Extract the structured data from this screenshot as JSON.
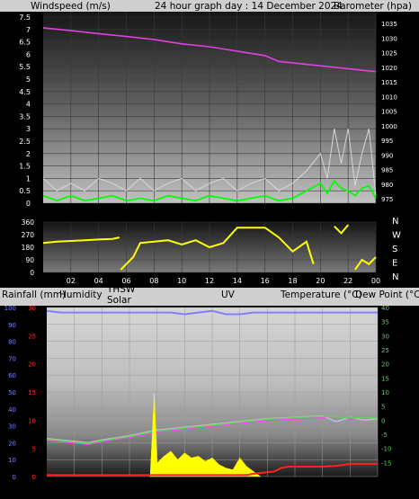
{
  "colors": {
    "background": "#000000",
    "label_bar": "#cfcfcf",
    "axis_text_dark": "#000000",
    "axis_text_light": "#ffffff",
    "pink": "#e040e0",
    "gust": "#d8d8d8",
    "wind": "#00ff00",
    "direction": "#ffff00",
    "humidity": "#8080ff",
    "thsw": "#c0c0c0",
    "temperature": "#ff40ff",
    "dewpoint": "#60d060",
    "solar": "#ffff00",
    "uv": "#ff2020"
  },
  "top": {
    "left_label": "Windspeed (m/s)",
    "title": "24 hour graph day : 14 December 2024",
    "right_label": "Barometer (hpa)"
  },
  "direction_letters": [
    "N",
    "W",
    "S",
    "E",
    "N"
  ],
  "bottom": {
    "labels": [
      "Rainfall (mm)",
      "Humidity",
      "THSW",
      "Solar",
      "UV",
      "Temperature (°C)",
      "Dew Point (°C)"
    ],
    "sunrise_label": "SunRise",
    "sunset_label": "SunSet"
  },
  "chart_data": [
    {
      "type": "line",
      "title": "24 hour graph day : 14 December 2024",
      "x_ticks": [
        "02",
        "04",
        "06",
        "08",
        "10",
        "12",
        "14",
        "16",
        "18",
        "20",
        "22",
        "00"
      ],
      "xlim_hours": [
        0,
        24
      ],
      "ylabel": "Windspeed (m/s)",
      "ylim": [
        0,
        7.5
      ],
      "y_ticks": [
        "0",
        "0.5",
        "1",
        "1.5",
        "2",
        "2.5",
        "3",
        "3.5",
        "4",
        "4.5",
        "5",
        "5.5",
        "6",
        "6.5",
        "7",
        "7.5"
      ],
      "y2label": "Barometer (hpa)",
      "y2lim": [
        973.5,
        1039
      ],
      "y2_ticks": [
        "975",
        "980",
        "985",
        "990",
        "995",
        "1000",
        "1005",
        "1010",
        "1015",
        "1020",
        "1025",
        "1030",
        "1035"
      ],
      "series": [
        {
          "name": "Barometer (hpa)",
          "axis": "right",
          "x": [
            0,
            2,
            4,
            6,
            8,
            10,
            12,
            14,
            16,
            17,
            18,
            20,
            22,
            24
          ],
          "values": [
            1033.5,
            1032.5,
            1031.5,
            1030.5,
            1029.5,
            1028,
            1027,
            1025.5,
            1024,
            1022,
            1021.5,
            1020.5,
            1019.5,
            1018.5
          ]
        },
        {
          "name": "Gust",
          "axis": "left",
          "x": [
            0,
            1,
            2,
            3,
            4,
            5,
            6,
            7,
            8,
            9,
            10,
            11,
            12,
            13,
            14,
            15,
            16,
            17,
            18,
            19,
            20,
            20.5,
            21,
            21.5,
            22,
            22.5,
            23,
            23.5,
            24
          ],
          "values": [
            1,
            0.5,
            0.8,
            0.5,
            1,
            0.8,
            0.5,
            1,
            0.5,
            0.8,
            1,
            0.5,
            0.8,
            1,
            0.5,
            0.8,
            1,
            0.5,
            0.8,
            1.3,
            2,
            1,
            3,
            1.6,
            3,
            0.7,
            2,
            3,
            0.3
          ]
        },
        {
          "name": "Windspeed",
          "axis": "left",
          "x": [
            0,
            1,
            2,
            3,
            4,
            5,
            6,
            7,
            8,
            9,
            10,
            11,
            12,
            13,
            14,
            15,
            16,
            17,
            18,
            19,
            20,
            20.5,
            21,
            21.5,
            22,
            22.5,
            23,
            23.5,
            24
          ],
          "values": [
            0.3,
            0.1,
            0.3,
            0.1,
            0.2,
            0.3,
            0.1,
            0.2,
            0.1,
            0.3,
            0.2,
            0.1,
            0.3,
            0.2,
            0.1,
            0.2,
            0.3,
            0.1,
            0.2,
            0.5,
            0.8,
            0.4,
            0.9,
            0.6,
            0.5,
            0.3,
            0.6,
            0.7,
            0.2
          ]
        }
      ]
    },
    {
      "type": "line",
      "x_ticks": [
        "02",
        "04",
        "06",
        "08",
        "10",
        "12",
        "14",
        "16",
        "18",
        "20",
        "22",
        "00"
      ],
      "xlim_hours": [
        0,
        24
      ],
      "ylim": [
        0,
        360
      ],
      "y_ticks": [
        "0",
        "90",
        "180",
        "270",
        "360"
      ],
      "right_ticks": [
        "N",
        "W",
        "S",
        "E",
        "N"
      ],
      "series": [
        {
          "name": "Wind direction",
          "x": [
            0,
            1,
            2,
            3,
            4,
            5,
            5.5,
            5.6,
            6,
            6.5,
            7,
            8,
            9,
            10,
            11,
            12,
            13,
            14,
            15,
            16,
            17,
            18,
            19,
            19.5,
            20,
            20.5,
            21,
            21.5,
            22,
            22.5,
            23,
            23.5,
            24
          ],
          "values": [
            210,
            220,
            225,
            230,
            235,
            240,
            250,
            20,
            60,
            110,
            210,
            220,
            230,
            200,
            230,
            180,
            210,
            320,
            320,
            320,
            250,
            150,
            220,
            60,
            330,
            20,
            330,
            280,
            340,
            20,
            90,
            60,
            110
          ]
        }
      ]
    },
    {
      "type": "line",
      "x_ticks": [
        "02",
        "04",
        "06",
        "08",
        "10",
        "12",
        "14",
        "16",
        "18",
        "20",
        "22",
        "00"
      ],
      "xlim_hours": [
        0,
        24
      ],
      "ylabel": "Rainfall (mm)",
      "ylim": [
        0,
        100
      ],
      "y_ticks": [
        "0",
        "10",
        "20",
        "30",
        "40",
        "50",
        "60",
        "70",
        "80",
        "90",
        "100"
      ],
      "y_ticks_inner": [
        "0",
        "5",
        "10",
        "15",
        "20",
        "25",
        "30"
      ],
      "y2label": "Temperature (°C)",
      "y2lim": [
        -20,
        40
      ],
      "y2_ticks": [
        "-15",
        "-10",
        "-5",
        "0",
        "5",
        "10",
        "15",
        "20",
        "25",
        "30",
        "35",
        "40"
      ],
      "series": [
        {
          "name": "Humidity",
          "axis": "left",
          "x": [
            0,
            1,
            2,
            3,
            4,
            5,
            6,
            7,
            8,
            9,
            10,
            11,
            12,
            13,
            14,
            15,
            16,
            17,
            18,
            19,
            20,
            21,
            22,
            23,
            24
          ],
          "values": [
            98,
            97,
            97,
            97,
            97,
            97,
            97,
            97,
            97,
            97,
            96,
            97,
            98,
            96,
            96,
            97,
            97,
            97,
            97,
            97,
            97,
            97,
            97,
            97,
            97
          ]
        },
        {
          "name": "Temperature (°C)",
          "axis": "right",
          "x": [
            0,
            2,
            3,
            4,
            6,
            8,
            10,
            12,
            14,
            16,
            18,
            20,
            22,
            24
          ],
          "values": [
            -7,
            -8,
            -8.5,
            -7.5,
            -6,
            -4,
            -3,
            -2,
            -1,
            0,
            0.5,
            1,
            0.5,
            0.5
          ]
        },
        {
          "name": "THSW",
          "axis": "right",
          "x": [
            0,
            2,
            3,
            4,
            6,
            8,
            10,
            12,
            14,
            16,
            18,
            20,
            21,
            22,
            23,
            24
          ],
          "values": [
            -6.5,
            -7.5,
            -8,
            -7,
            -5.5,
            -3.5,
            -2.5,
            -1.5,
            -0.5,
            0.5,
            1,
            1.5,
            -0.5,
            1,
            0,
            0.5
          ]
        },
        {
          "name": "Dew Point (°C)",
          "axis": "right",
          "x": [
            0,
            2,
            3,
            4,
            6,
            8,
            10,
            12,
            14,
            16,
            18,
            20,
            22,
            24
          ],
          "values": [
            -6.8,
            -7.8,
            -8.3,
            -7.3,
            -5.8,
            -3.8,
            -2.8,
            -1.8,
            -0.8,
            0.3,
            0.8,
            1.3,
            0.8,
            0.8
          ]
        },
        {
          "name": "Solar",
          "axis": "left",
          "x": [
            7.5,
            7.8,
            8,
            8.5,
            9,
            9.5,
            10,
            10.5,
            11,
            11.5,
            12,
            12.5,
            13,
            13.5,
            14,
            14.5,
            15,
            15.5
          ],
          "values": [
            0,
            49,
            8,
            12,
            15,
            10,
            14,
            11,
            12,
            9,
            11,
            7,
            5,
            4,
            11,
            6,
            3,
            0
          ]
        },
        {
          "name": "UV",
          "axis": "right",
          "x": [
            0,
            14.5,
            15,
            16.5,
            17,
            17.5,
            18,
            20,
            21,
            22,
            24
          ],
          "values": [
            -19.5,
            -19.5,
            -19,
            -18.2,
            -17,
            -16.5,
            -16.5,
            -16.5,
            -16.2,
            -15.5,
            -15.5
          ]
        }
      ],
      "annotations": [
        "SunRise",
        "SunSet"
      ]
    }
  ]
}
